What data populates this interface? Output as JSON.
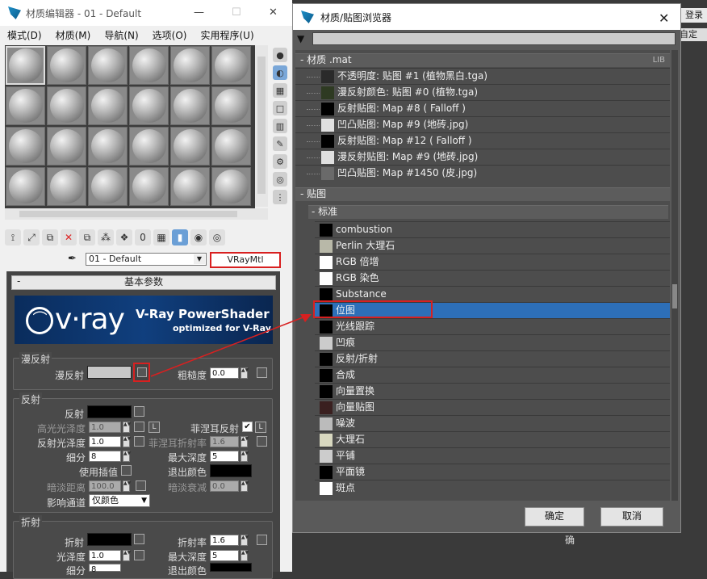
{
  "material_editor": {
    "title": "材质编辑器 - 01 - Default",
    "menu": [
      "模式(D)",
      "材质(M)",
      "导航(N)",
      "选项(O)",
      "实用程序(U)"
    ],
    "material_name": "01 - Default",
    "material_type": "VRayMtl",
    "rollout_title": "基本参数",
    "vray_banner": {
      "logo": "v·ray",
      "line1": "V-Ray PowerShader",
      "line2": "optimized for V-Ray"
    },
    "diffuse": {
      "group": "漫反射",
      "label": "漫反射",
      "roughness_label": "粗糙度",
      "roughness": "0.0"
    },
    "reflection": {
      "group": "反射",
      "reflect": "反射",
      "hilight_gloss": "高光光泽度",
      "hilight_gloss_val": "1.0",
      "l_btn": "L",
      "fresnel": "菲涅耳反射",
      "refl_gloss": "反射光泽度",
      "refl_gloss_val": "1.0",
      "fresnel_ior": "菲涅耳折射率",
      "fresnel_ior_val": "1.6",
      "subdivs": "细分",
      "subdivs_val": "8",
      "max_depth": "最大深度",
      "max_depth_val": "5",
      "use_interp": "使用插值",
      "exit_color": "退出颜色",
      "dim_dist": "暗淡距离",
      "dim_dist_val": "100.0",
      "dim_falloff": "暗淡衰减",
      "dim_falloff_val": "0.0",
      "affect_ch": "影响通道",
      "affect_ch_val": "仅颜色"
    },
    "refraction": {
      "group": "折射",
      "refract": "折射",
      "ior": "折射率",
      "ior_val": "1.6",
      "gloss": "光泽度",
      "gloss_val": "1.0",
      "max_depth": "最大深度",
      "max_depth_val": "5",
      "subdivs": "细分",
      "subdivs_val": "8",
      "exit_color": "退出颜色"
    }
  },
  "browser": {
    "title": "材质/贴图浏览器",
    "mat_section": "- 材质 .mat",
    "lib_tag": "LIB",
    "mat_items": [
      "不透明度: 贴图 #1 (植物黑白.tga)",
      "漫反射颜色: 贴图 #0 (植物.tga)",
      "反射贴图: Map #8 ( Falloff )",
      "凹凸贴图: Map #9 (地砖.jpg)",
      "反射贴图: Map #12 ( Falloff )",
      "漫反射贴图: Map #9 (地砖.jpg)",
      "凹凸贴图: Map #1450 (皮.jpg)"
    ],
    "maps_section": "- 贴图",
    "standard_section": "- 标准",
    "map_items": [
      "combustion",
      "Perlin 大理石",
      "RGB 倍增",
      "RGB 染色",
      "Substance",
      "位图",
      "光线跟踪",
      "凹痕",
      "反射/折射",
      "合成",
      "向量置换",
      "向量贴图",
      "噪波",
      "大理石",
      "平铺",
      "平面镜",
      "斑点"
    ],
    "selected_map": "位图",
    "ok": "确定",
    "cancel": "取消"
  },
  "background": {
    "login": "登录",
    "custom": "自定",
    "bottom_text": "确"
  },
  "colors": {
    "highlight_row": "#2d6fb8",
    "red_annotation": "#d82020"
  }
}
